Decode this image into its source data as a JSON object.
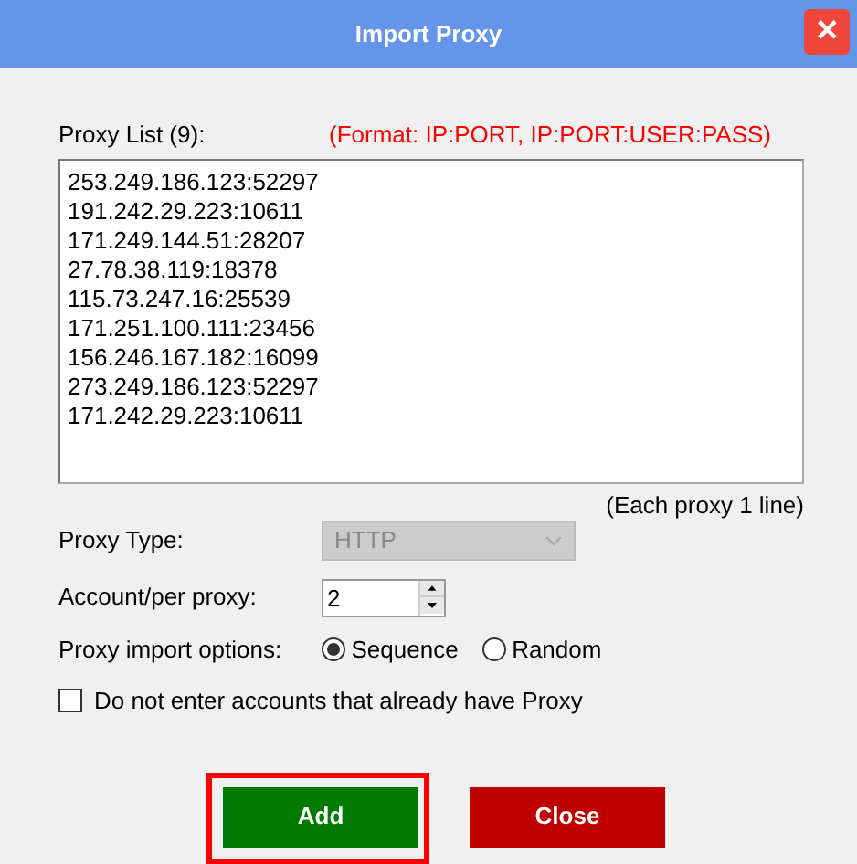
{
  "window": {
    "title": "Import Proxy",
    "close_symbol": "✕"
  },
  "proxy_list": {
    "label": "Proxy List (9):",
    "format_hint": "(Format: IP:PORT, IP:PORT:USER:PASS)",
    "entries": [
      "253.249.186.123:52297",
      "191.242.29.223:10611",
      "171.249.144.51:28207",
      "27.78.38.119:18378",
      "115.73.247.16:25539",
      "171.251.100.111:23456",
      "156.246.167.182:16099",
      "273.249.186.123:52297",
      "171.242.29.223:10611"
    ],
    "note": "(Each proxy 1 line)"
  },
  "proxy_type": {
    "label": "Proxy Type:",
    "value": "HTTP",
    "disabled": true
  },
  "account_per_proxy": {
    "label": "Account/per proxy:",
    "value": "2"
  },
  "import_options": {
    "label": "Proxy import options:",
    "options": [
      {
        "label": "Sequence",
        "selected": true
      },
      {
        "label": "Random",
        "selected": false
      }
    ]
  },
  "skip_existing": {
    "label": "Do not enter accounts that already have Proxy",
    "checked": false
  },
  "buttons": [
    {
      "label": "Add",
      "kind": "add",
      "focused": true
    },
    {
      "label": "Close",
      "kind": "close",
      "focused": false
    }
  ]
}
